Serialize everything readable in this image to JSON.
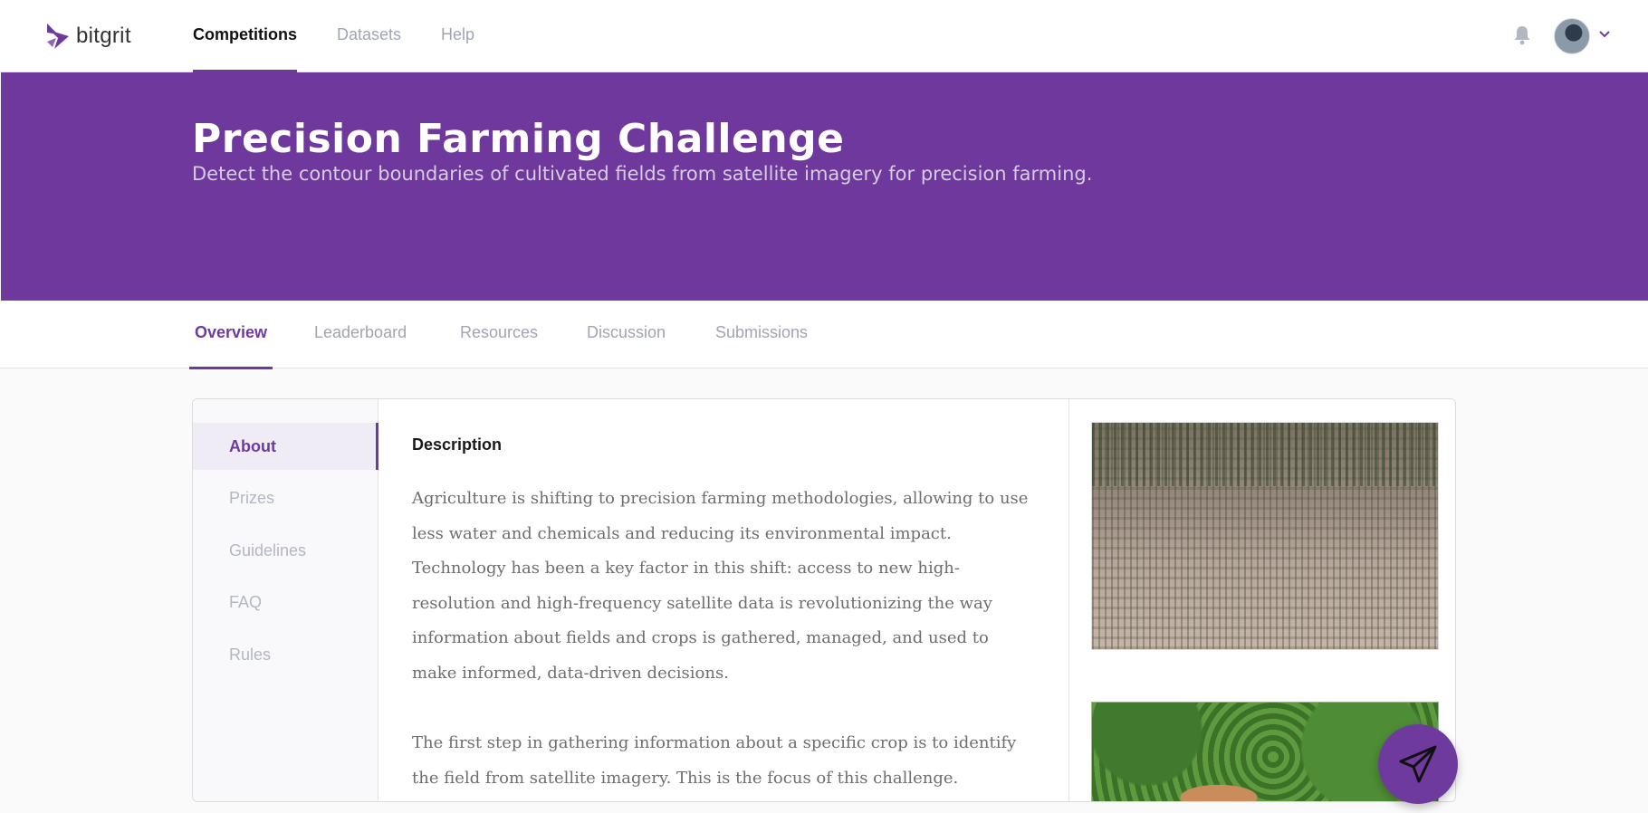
{
  "brand": {
    "name": "bitgrit",
    "accent": "#6f3a9e"
  },
  "topnav": {
    "items": [
      {
        "label": "Competitions",
        "active": true
      },
      {
        "label": "Datasets",
        "active": false
      },
      {
        "label": "Help",
        "active": false
      }
    ]
  },
  "user": {
    "icons": [
      "bell-icon",
      "avatar",
      "chevron-down-icon"
    ]
  },
  "hero": {
    "title": "Precision Farming Challenge",
    "subtitle": "Detect the contour boundaries of cultivated fields from satellite imagery for precision farming.",
    "background": "#6f389d"
  },
  "tabs": [
    {
      "label": "Overview",
      "active": true
    },
    {
      "label": "Leaderboard",
      "active": false
    },
    {
      "label": "Resources",
      "active": false
    },
    {
      "label": "Discussion",
      "active": false
    },
    {
      "label": "Submissions",
      "active": false
    }
  ],
  "sidebar": {
    "items": [
      {
        "label": "About",
        "active": true
      },
      {
        "label": "Prizes",
        "active": false
      },
      {
        "label": "Guidelines",
        "active": false
      },
      {
        "label": "FAQ",
        "active": false
      },
      {
        "label": "Rules",
        "active": false
      }
    ]
  },
  "main": {
    "heading": "Description",
    "paragraphs": [
      "Agriculture is shifting to precision farming methodologies, allowing to use less water and chemicals and reducing its environmental impact. Technology has been a key factor in this shift: access to new high-resolution and high-frequency satellite data is revolutionizing the way information about fields and crops is gathered, managed, and used to make informed, data-driven decisions.",
      "The first step in gathering information about a specific crop is to identify the field from satellite imagery. This is the focus of this challenge."
    ]
  },
  "images": [
    "aerial-field-image",
    "aerial-forest-image"
  ],
  "fab": {
    "icon": "send-icon"
  }
}
